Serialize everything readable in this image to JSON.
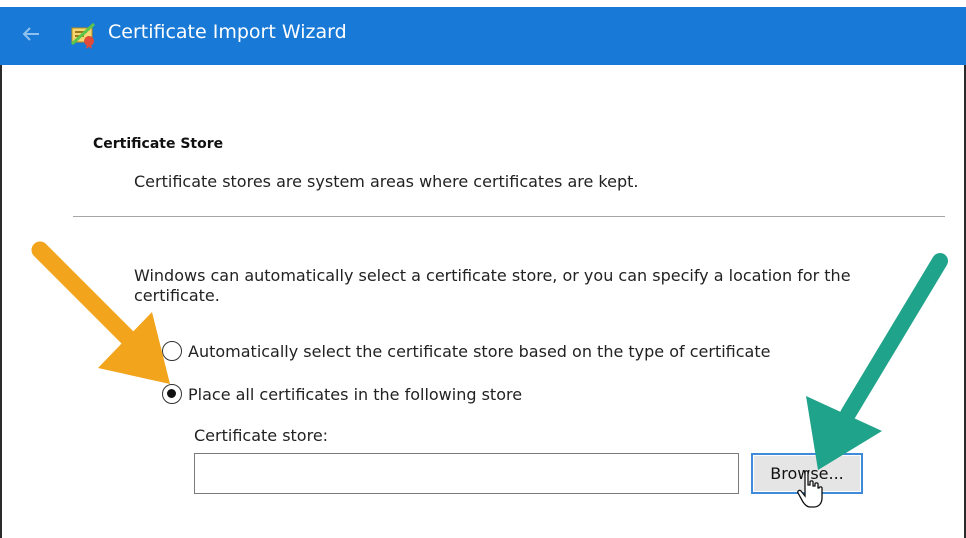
{
  "window": {
    "title": "Certificate Import Wizard",
    "back_icon": "back-arrow-icon",
    "app_icon": "certificate-icon",
    "titlebar_color": "#1979d6"
  },
  "section": {
    "heading": "Certificate Store",
    "description": "Certificate stores are system areas where certificates are kept."
  },
  "intro": "Windows can automatically select a certificate store, or you can specify a location for the certificate.",
  "options": [
    {
      "label": "Automatically select the certificate store based on the type of certificate",
      "selected": false
    },
    {
      "label": "Place all certificates in the following store",
      "selected": true
    }
  ],
  "store": {
    "label": "Certificate store:",
    "value": "",
    "browse_label": "Browse..."
  },
  "annotations": {
    "left_arrow_color": "#f2a51c",
    "right_arrow_color": "#1fa38a"
  }
}
